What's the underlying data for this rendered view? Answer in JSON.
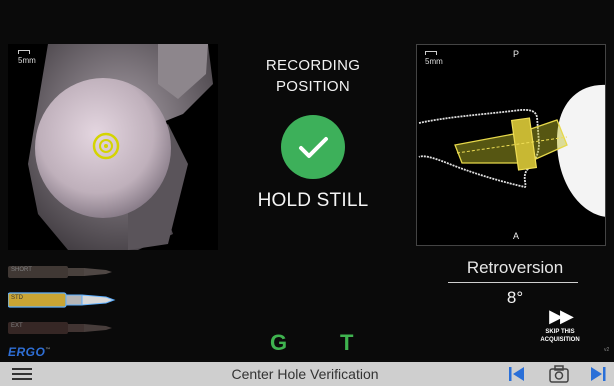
{
  "left_view": {
    "scale_label": "5mm"
  },
  "status": {
    "line1": "RECORDING",
    "line2": "POSITION",
    "icon": "check-icon",
    "message": "HOLD STILL",
    "color": "#3db05a"
  },
  "right_view": {
    "scale_label": "5mm",
    "top_label": "P",
    "bottom_label": "A"
  },
  "measurement": {
    "label": "Retroversion",
    "value": "8°"
  },
  "skip": {
    "line1": "SKIP THIS",
    "line2": "ACQUISITION",
    "icon": "fast-forward-icon"
  },
  "version": "v2",
  "drills": [
    {
      "label": "SHORT",
      "selected": false
    },
    {
      "label": "STD",
      "selected": true
    },
    {
      "label": "EXT",
      "selected": false
    }
  ],
  "brand": {
    "name": "ERGO",
    "mark": "™",
    "color": "#2f6fd6"
  },
  "indicators": {
    "g": "G",
    "t": "T",
    "color": "#3fb34f"
  },
  "bottom_bar": {
    "title": "Center Hole Verification",
    "menu_icon": "hamburger-menu-icon",
    "prev_icon": "skip-back-icon",
    "camera_icon": "camera-icon",
    "next_icon": "skip-forward-icon",
    "accent": "#2a6fd8"
  }
}
